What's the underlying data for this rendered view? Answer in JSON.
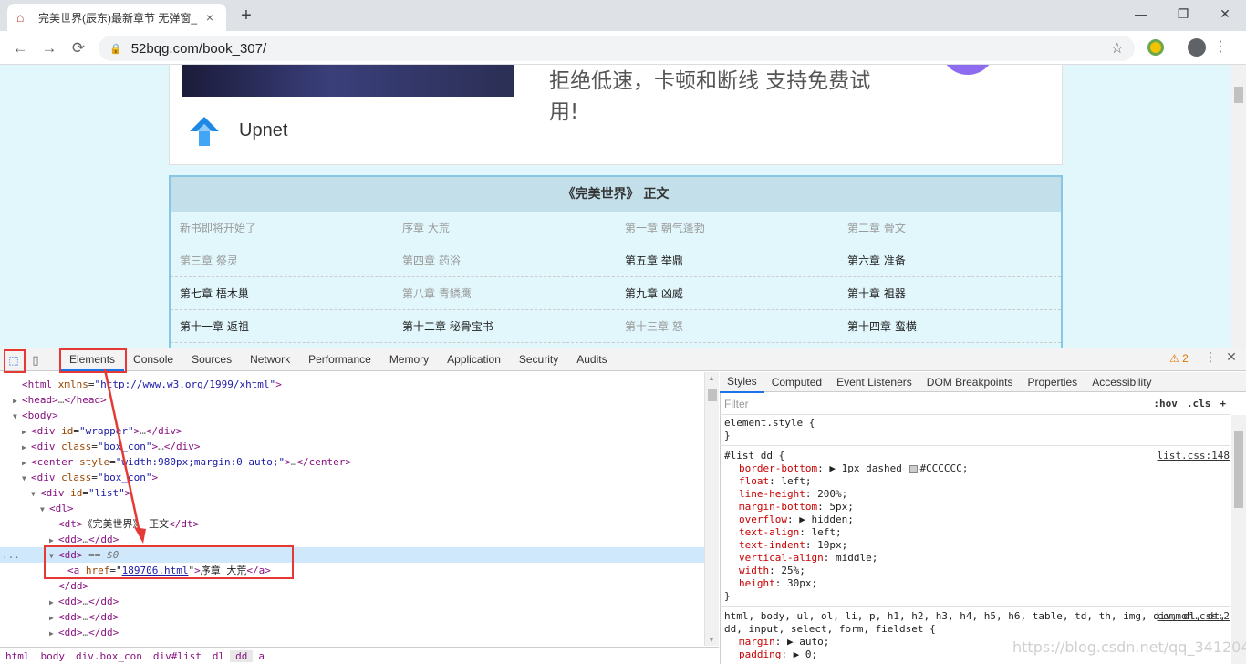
{
  "browser": {
    "tab_title": "完美世界(辰东)最新章节 无弹窗_",
    "tab_close": "×",
    "new_tab": "+",
    "window_controls": [
      "—",
      "❐",
      "✕"
    ],
    "url": "52bqg.com/book_307/",
    "nav": {
      "back": "←",
      "forward": "→",
      "reload": "⟳"
    },
    "icons": [
      "favicon-house-icon",
      "lock-icon",
      "star-icon",
      "extension-icon",
      "profile-icon",
      "menu-icon"
    ]
  },
  "page": {
    "ad": {
      "text": "拒绝低速，卡顿和断线 支持免费试用!",
      "brand": "Upnet"
    },
    "chapter_list": {
      "header": "《完美世界》 正文",
      "rows": [
        [
          {
            "t": "新书即将开始了",
            "v": true
          },
          {
            "t": "序章 大荒",
            "v": true
          },
          {
            "t": "第一章 朝气蓬勃",
            "v": true
          },
          {
            "t": "第二章 骨文",
            "v": true
          }
        ],
        [
          {
            "t": "第三章 祭灵",
            "v": true
          },
          {
            "t": "第四章 药浴",
            "v": true
          },
          {
            "t": "第五章 举鼎",
            "v": false
          },
          {
            "t": "第六章 准备",
            "v": false
          }
        ],
        [
          {
            "t": "第七章 梧木巢",
            "v": false
          },
          {
            "t": "第八章 青鳞鹰",
            "v": true
          },
          {
            "t": "第九章 凶威",
            "v": false
          },
          {
            "t": "第十章 祖器",
            "v": false
          }
        ],
        [
          {
            "t": "第十一章 返祖",
            "v": false
          },
          {
            "t": "第十二章 秘骨宝书",
            "v": false
          },
          {
            "t": "第十三章 怒",
            "v": true
          },
          {
            "t": "第十四章 蛮横",
            "v": false
          }
        ]
      ]
    }
  },
  "devtools": {
    "tabs": [
      "Elements",
      "Console",
      "Sources",
      "Network",
      "Performance",
      "Memory",
      "Application",
      "Security",
      "Audits"
    ],
    "active_tab": "Elements",
    "warning_count": "2",
    "warning_icon": "⚠",
    "menu": "⋮",
    "close": "✕",
    "inspect_icon": "⬚",
    "device_icon": "▯",
    "elements_lines": [
      {
        "indent": 0,
        "html": "<span class='tag'>&lt;html</span> <span class='attr'>xmlns</span>=<span class='val'>\"http://www.w3.org/1999/xhtml\"</span><span class='tag'>&gt;</span>",
        "tri": ""
      },
      {
        "indent": 0,
        "html": "<span class='tag'>&lt;head&gt;</span><span class='dots'>…</span><span class='tag'>&lt;/head&gt;</span>",
        "tri": "▶"
      },
      {
        "indent": 0,
        "html": "<span class='tag'>&lt;body&gt;</span>",
        "tri": "▼"
      },
      {
        "indent": 1,
        "html": "<span class='tag'>&lt;div</span> <span class='attr'>id</span>=<span class='val'>\"wrapper\"</span><span class='tag'>&gt;</span><span class='dots'>…</span><span class='tag'>&lt;/div&gt;</span>",
        "tri": "▶"
      },
      {
        "indent": 1,
        "html": "<span class='tag'>&lt;div</span> <span class='attr'>class</span>=<span class='val'>\"box_con\"</span><span class='tag'>&gt;</span><span class='dots'>…</span><span class='tag'>&lt;/div&gt;</span>",
        "tri": "▶"
      },
      {
        "indent": 1,
        "html": "<span class='tag'>&lt;center</span> <span class='attr'>style</span>=<span class='val'>\"width:980px;margin:0 auto;\"</span><span class='tag'>&gt;</span><span class='dots'>…</span><span class='tag'>&lt;/center&gt;</span>",
        "tri": "▶"
      },
      {
        "indent": 1,
        "html": "<span class='tag'>&lt;div</span> <span class='attr'>class</span>=<span class='val'>\"box_con\"</span><span class='tag'>&gt;</span>",
        "tri": "▼"
      },
      {
        "indent": 2,
        "html": "<span class='tag'>&lt;div</span> <span class='attr'>id</span>=<span class='val'>\"list\"</span><span class='tag'>&gt;</span>",
        "tri": "▼"
      },
      {
        "indent": 3,
        "html": "<span class='tag'>&lt;dl&gt;</span>",
        "tri": "▼"
      },
      {
        "indent": 4,
        "html": "<span class='tag'>&lt;dt&gt;</span><span class='txt'>《完美世界》 正文</span><span class='tag'>&lt;/dt&gt;</span>",
        "tri": ""
      },
      {
        "indent": 4,
        "html": "<span class='tag'>&lt;dd&gt;</span><span class='dots'>…</span><span class='tag'>&lt;/dd&gt;</span>",
        "tri": "▶"
      },
      {
        "indent": 4,
        "html": "<span class='tag'>&lt;dd&gt;</span> <span class='eq'>== $0</span>",
        "tri": "▼",
        "selected": true
      },
      {
        "indent": 5,
        "html": "<span class='tag'>&lt;a</span> <span class='attr'>href</span>=\"<span class='link'>189706.html</span>\"<span class='tag'>&gt;</span><span class='txt'>序章 大荒</span><span class='tag'>&lt;/a&gt;</span>",
        "tri": ""
      },
      {
        "indent": 4,
        "html": "<span class='tag'>&lt;/dd&gt;</span>",
        "tri": ""
      },
      {
        "indent": 4,
        "html": "<span class='tag'>&lt;dd&gt;</span><span class='dots'>…</span><span class='tag'>&lt;/dd&gt;</span>",
        "tri": "▶"
      },
      {
        "indent": 4,
        "html": "<span class='tag'>&lt;dd&gt;</span><span class='dots'>…</span><span class='tag'>&lt;/dd&gt;</span>",
        "tri": "▶"
      },
      {
        "indent": 4,
        "html": "<span class='tag'>&lt;dd&gt;</span><span class='dots'>…</span><span class='tag'>&lt;/dd&gt;</span>",
        "tri": "▶"
      }
    ],
    "selected_marker": "...",
    "breadcrumbs": [
      "html",
      "body",
      "div.box_con",
      "div#list",
      "dl",
      "dd",
      "a"
    ],
    "active_crumb": "dd",
    "styles_tabs": [
      "Styles",
      "Computed",
      "Event Listeners",
      "DOM Breakpoints",
      "Properties",
      "Accessibility"
    ],
    "filter_placeholder": "Filter",
    "filter_buttons": [
      ":hov",
      ".cls",
      "+"
    ],
    "rules": [
      {
        "selector": "element.style {",
        "source": "",
        "props": [],
        "close": "}"
      },
      {
        "selector": "#list dd {",
        "source": "list.css:148",
        "props": [
          {
            "n": "border-bottom",
            "v": "▶ 1px dashed ",
            "swatch": true,
            "v2": "#CCCCCC;"
          },
          {
            "n": "float",
            "v": "left;"
          },
          {
            "n": "line-height",
            "v": "200%;"
          },
          {
            "n": "margin-bottom",
            "v": "5px;"
          },
          {
            "n": "overflow",
            "v": "▶ hidden;"
          },
          {
            "n": "text-align",
            "v": "left;"
          },
          {
            "n": "text-indent",
            "v": "10px;"
          },
          {
            "n": "vertical-align",
            "v": "middle;"
          },
          {
            "n": "width",
            "v": "25%;"
          },
          {
            "n": "height",
            "v": "30px;"
          }
        ],
        "close": "}"
      },
      {
        "selector": "html, body, ul, ol, li, p, h1, h2, h3, h4, h5, h6, table, td, th, img, div, dl, dt, dd, input, select, form, fieldset {",
        "source": "common.css:2",
        "props": [
          {
            "n": "margin",
            "v": "▶ auto;"
          },
          {
            "n": "padding",
            "v": "▶ 0;"
          }
        ],
        "close": ""
      }
    ]
  },
  "watermark": "https://blog.csdn.net/qq_34120459",
  "colors": {
    "annotation": "#e53935",
    "page_bg": "#e1f7fc",
    "header_bg": "#c3dfea",
    "border": "#88c6e5"
  }
}
